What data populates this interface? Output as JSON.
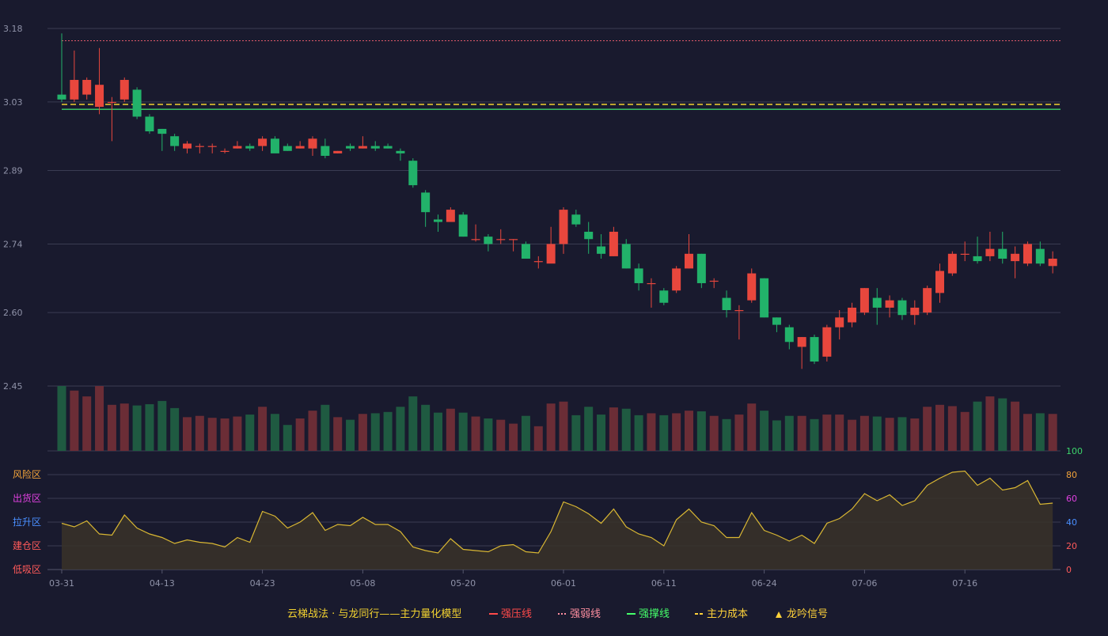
{
  "colors": {
    "background": "#191a2e",
    "up": "#e8473d",
    "down": "#22b26a",
    "vol_up": "#6b2d36",
    "vol_down": "#1f5a41",
    "grid": "#3a3c52",
    "resistance": "#ff3b3b",
    "weak_strong": "#e05a6a",
    "support": "#3cd46a",
    "main_cost": "#f2d230",
    "osc_line": "#d9b733",
    "osc_fill": "#3a3328"
  },
  "legend": {
    "title": "云梯战法 · 与龙同行——主力量化模型",
    "items": [
      {
        "label": "强压线",
        "color": "#ff4a4a",
        "style": "solid"
      },
      {
        "label": "强弱线",
        "color": "#ff8fa0",
        "style": "dotted"
      },
      {
        "label": "强撑线",
        "color": "#45ff6a",
        "style": "solid"
      },
      {
        "label": "主力成本",
        "color": "#ffd23a",
        "style": "dashed"
      },
      {
        "label": "龙吟信号",
        "color": "#ffd23a",
        "style": "triangle"
      }
    ]
  },
  "chart_data": {
    "type": "candlestick",
    "price_axis": {
      "ticks": [
        "3.18",
        "3.03",
        "2.89",
        "2.74",
        "2.60",
        "2.45"
      ],
      "range": [
        2.45,
        3.18
      ]
    },
    "osc_axis": {
      "ticks": [
        "100",
        "80",
        "60",
        "40",
        "20",
        "0"
      ],
      "range": [
        0,
        100
      ],
      "tick_colors": [
        "#3cd46a",
        "#f2a33a",
        "#e040e0",
        "#4a8fff",
        "#ff5a5a",
        "#ff5a5a"
      ]
    },
    "zones": [
      {
        "label": "风险区",
        "color": "#f2a33a"
      },
      {
        "label": "出货区",
        "color": "#e040e0"
      },
      {
        "label": "拉升区",
        "color": "#4a8fff"
      },
      {
        "label": "建仓区",
        "color": "#ff5a5a"
      },
      {
        "label": "低吸区",
        "color": "#ff5a5a"
      }
    ],
    "x_ticks": [
      {
        "i": 0,
        "label": "03-31"
      },
      {
        "i": 8,
        "label": "04-13"
      },
      {
        "i": 16,
        "label": "04-23"
      },
      {
        "i": 24,
        "label": "05-08"
      },
      {
        "i": 32,
        "label": "05-20"
      },
      {
        "i": 40,
        "label": "06-01"
      },
      {
        "i": 48,
        "label": "06-11"
      },
      {
        "i": 56,
        "label": "06-24"
      },
      {
        "i": 64,
        "label": "07-06"
      },
      {
        "i": 72,
        "label": "07-16"
      }
    ],
    "lines": {
      "resistance": 3.155,
      "weak_strong": 3.155,
      "main_cost": 3.025,
      "support": 3.015
    },
    "candles": [
      [
        3.045,
        3.035,
        3.17,
        3.03
      ],
      [
        3.035,
        3.075,
        3.135,
        3.03
      ],
      [
        3.045,
        3.075,
        3.08,
        3.035
      ],
      [
        3.02,
        3.065,
        3.14,
        3.005
      ],
      [
        3.03,
        3.03,
        3.04,
        2.95
      ],
      [
        3.035,
        3.075,
        3.08,
        3.03
      ],
      [
        3.055,
        3.0,
        3.06,
        2.995
      ],
      [
        3.0,
        2.97,
        3.005,
        2.965
      ],
      [
        2.975,
        2.965,
        2.975,
        2.93
      ],
      [
        2.96,
        2.94,
        2.965,
        2.93
      ],
      [
        2.935,
        2.945,
        2.95,
        2.925
      ],
      [
        2.94,
        2.94,
        2.945,
        2.925
      ],
      [
        2.94,
        2.94,
        2.945,
        2.925
      ],
      [
        2.93,
        2.93,
        2.935,
        2.925
      ],
      [
        2.935,
        2.94,
        2.95,
        2.935
      ],
      [
        2.94,
        2.935,
        2.945,
        2.93
      ],
      [
        2.94,
        2.955,
        2.96,
        2.93
      ],
      [
        2.955,
        2.925,
        2.96,
        2.935
      ],
      [
        2.94,
        2.93,
        2.945,
        2.93
      ],
      [
        2.935,
        2.94,
        2.95,
        2.935
      ],
      [
        2.935,
        2.955,
        2.96,
        2.92
      ],
      [
        2.94,
        2.92,
        2.955,
        2.915
      ],
      [
        2.925,
        2.93,
        2.93,
        2.925
      ],
      [
        2.94,
        2.935,
        2.945,
        2.93
      ],
      [
        2.935,
        2.94,
        2.96,
        2.935
      ],
      [
        2.94,
        2.935,
        2.95,
        2.93
      ],
      [
        2.94,
        2.935,
        2.945,
        2.935
      ],
      [
        2.93,
        2.925,
        2.935,
        2.91
      ],
      [
        2.91,
        2.86,
        2.915,
        2.855
      ],
      [
        2.845,
        2.805,
        2.85,
        2.775
      ],
      [
        2.79,
        2.785,
        2.8,
        2.765
      ],
      [
        2.785,
        2.81,
        2.815,
        2.79
      ],
      [
        2.8,
        2.755,
        2.805,
        2.755
      ],
      [
        2.75,
        2.75,
        2.78,
        2.745
      ],
      [
        2.755,
        2.74,
        2.76,
        2.725
      ],
      [
        2.75,
        2.75,
        2.77,
        2.74
      ],
      [
        2.75,
        2.75,
        2.75,
        2.725
      ],
      [
        2.74,
        2.71,
        2.745,
        2.71
      ],
      [
        2.705,
        2.705,
        2.715,
        2.69
      ],
      [
        2.7,
        2.74,
        2.775,
        2.71
      ],
      [
        2.74,
        2.81,
        2.815,
        2.72
      ],
      [
        2.8,
        2.78,
        2.81,
        2.775
      ],
      [
        2.765,
        2.75,
        2.785,
        2.72
      ],
      [
        2.735,
        2.72,
        2.76,
        2.71
      ],
      [
        2.715,
        2.765,
        2.775,
        2.715
      ],
      [
        2.74,
        2.69,
        2.75,
        2.69
      ],
      [
        2.69,
        2.66,
        2.7,
        2.645
      ],
      [
        2.66,
        2.66,
        2.67,
        2.61
      ],
      [
        2.645,
        2.62,
        2.65,
        2.615
      ],
      [
        2.645,
        2.69,
        2.695,
        2.64
      ],
      [
        2.69,
        2.72,
        2.76,
        2.69
      ],
      [
        2.72,
        2.66,
        2.72,
        2.65
      ],
      [
        2.665,
        2.665,
        2.67,
        2.65
      ],
      [
        2.63,
        2.605,
        2.645,
        2.59
      ],
      [
        2.605,
        2.605,
        2.615,
        2.545
      ],
      [
        2.625,
        2.68,
        2.69,
        2.62
      ],
      [
        2.67,
        2.59,
        2.67,
        2.59
      ],
      [
        2.59,
        2.575,
        2.59,
        2.56
      ],
      [
        2.57,
        2.54,
        2.575,
        2.525
      ],
      [
        2.53,
        2.55,
        2.55,
        2.485
      ],
      [
        2.55,
        2.5,
        2.555,
        2.495
      ],
      [
        2.51,
        2.57,
        2.575,
        2.5
      ],
      [
        2.57,
        2.59,
        2.605,
        2.545
      ],
      [
        2.58,
        2.61,
        2.62,
        2.57
      ],
      [
        2.6,
        2.65,
        2.65,
        2.595
      ],
      [
        2.63,
        2.61,
        2.65,
        2.575
      ],
      [
        2.61,
        2.625,
        2.635,
        2.59
      ],
      [
        2.625,
        2.595,
        2.63,
        2.585
      ],
      [
        2.595,
        2.61,
        2.625,
        2.575
      ],
      [
        2.6,
        2.65,
        2.655,
        2.595
      ],
      [
        2.64,
        2.685,
        2.7,
        2.62
      ],
      [
        2.68,
        2.72,
        2.725,
        2.675
      ],
      [
        2.72,
        2.72,
        2.745,
        2.705
      ],
      [
        2.715,
        2.705,
        2.755,
        2.7
      ],
      [
        2.715,
        2.73,
        2.765,
        2.705
      ],
      [
        2.73,
        2.71,
        2.765,
        2.7
      ],
      [
        2.705,
        2.72,
        2.735,
        2.67
      ],
      [
        2.7,
        2.74,
        2.745,
        2.695
      ],
      [
        2.73,
        2.7,
        2.745,
        2.695
      ],
      [
        2.695,
        2.71,
        2.725,
        2.68
      ]
    ],
    "volume": [
      100,
      93,
      84,
      100,
      71,
      73,
      70,
      72,
      77,
      66,
      52,
      54,
      51,
      50,
      53,
      56,
      68,
      57,
      40,
      50,
      62,
      71,
      52,
      48,
      57,
      58,
      60,
      68,
      84,
      71,
      59,
      65,
      59,
      53,
      50,
      48,
      42,
      54,
      38,
      73,
      76,
      55,
      68,
      56,
      67,
      65,
      55,
      58,
      55,
      58,
      62,
      61,
      54,
      49,
      56,
      73,
      62,
      47,
      54,
      54,
      49,
      56,
      56,
      48,
      54,
      53,
      51,
      52,
      50,
      68,
      71,
      69,
      60,
      76,
      84,
      81,
      76,
      57,
      58,
      57
    ],
    "oscillator": [
      39,
      36,
      41,
      30,
      29,
      46,
      35,
      30,
      27,
      22,
      25,
      23,
      22,
      19,
      27,
      23,
      49,
      45,
      35,
      40,
      48,
      33,
      38,
      37,
      44,
      38,
      38,
      32,
      19,
      16,
      14,
      26,
      17,
      16,
      15,
      20,
      21,
      15,
      14,
      32,
      57,
      53,
      47,
      39,
      51,
      36,
      30,
      27,
      20,
      42,
      51,
      40,
      37,
      27,
      27,
      48,
      33,
      29,
      24,
      29,
      22,
      39,
      43,
      51,
      64,
      58,
      63,
      54,
      58,
      71,
      77,
      82,
      83,
      71,
      77,
      67,
      69,
      75,
      55,
      56
    ]
  }
}
